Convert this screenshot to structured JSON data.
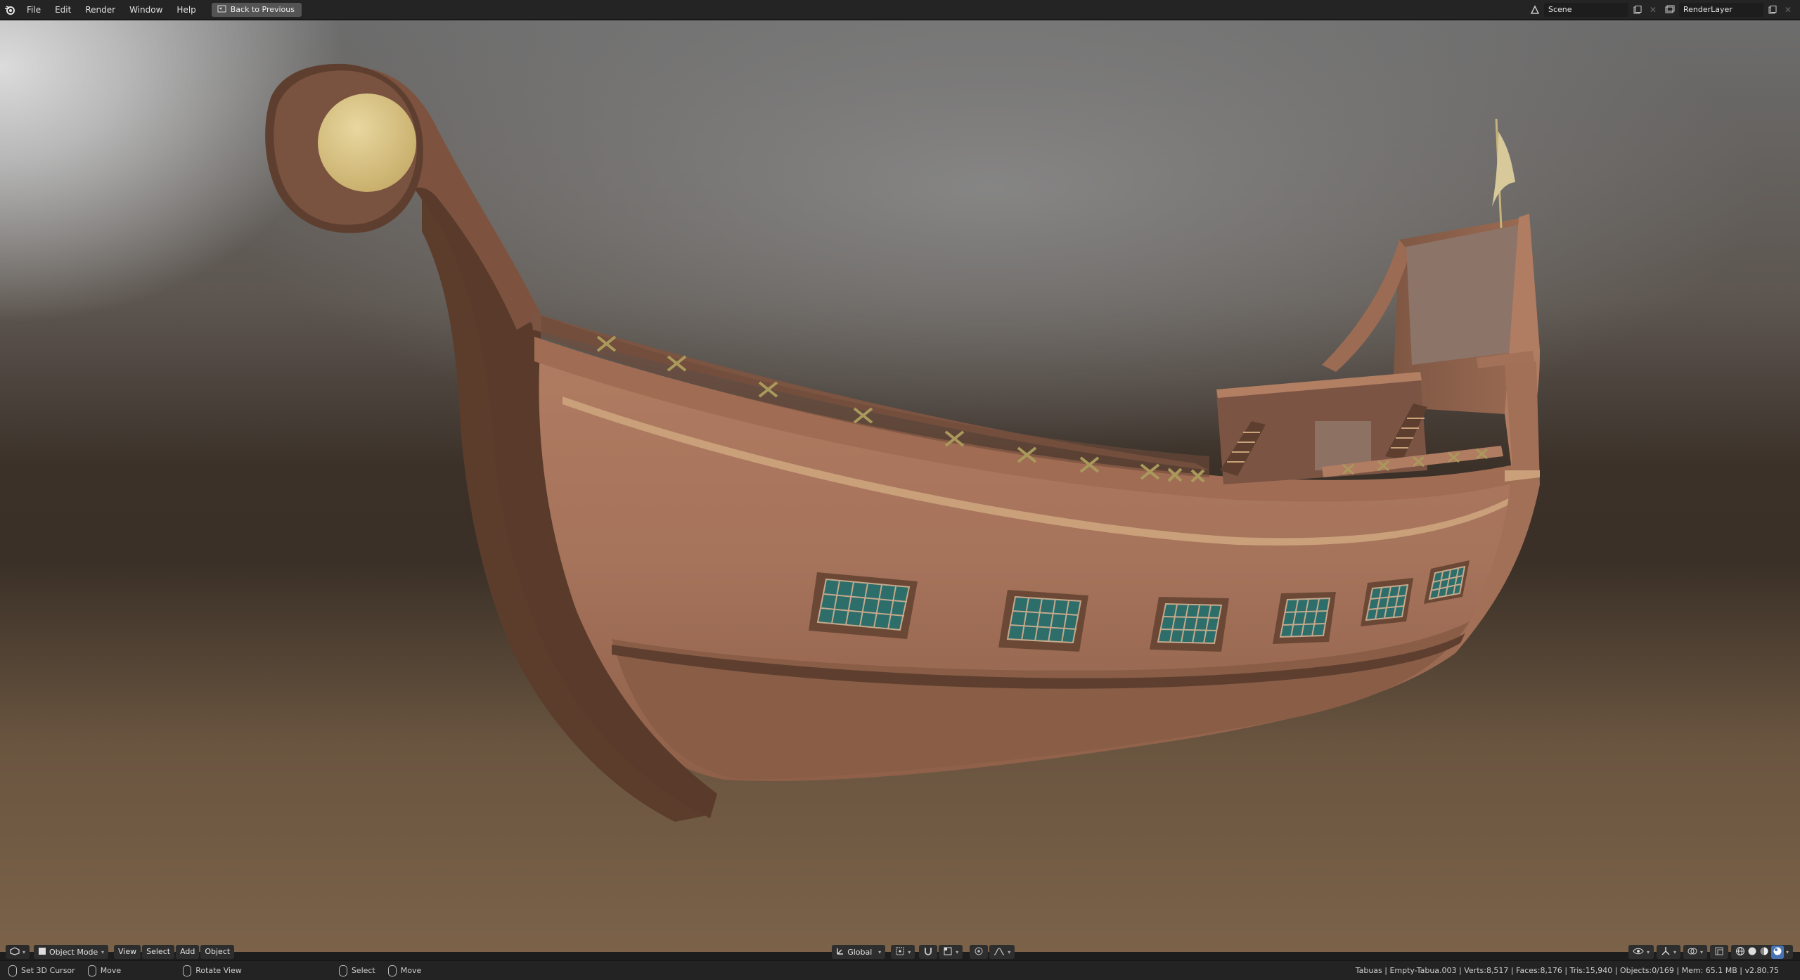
{
  "topbar": {
    "menu": [
      "File",
      "Edit",
      "Render",
      "Window",
      "Help"
    ],
    "back_button": "Back to Previous",
    "scene": "Scene",
    "render_layer": "RenderLayer"
  },
  "viewport_header": {
    "editor_icon": "3d-viewport-icon",
    "mode": "Object Mode",
    "menus": [
      "View",
      "Select",
      "Add",
      "Object"
    ],
    "transform_orientation": "Global"
  },
  "statusbar": {
    "hints": [
      {
        "label": "Set 3D Cursor",
        "icon": "mouse-left-icon"
      },
      {
        "label": "Move",
        "icon": "mouse-left-drag-icon"
      },
      {
        "label": "Rotate View",
        "icon": "mouse-middle-icon"
      },
      {
        "label": "Select",
        "icon": "mouse-right-icon"
      },
      {
        "label": "Move",
        "icon": "mouse-right-drag-icon"
      }
    ],
    "stats": "Tabuas | Empty-Tabua.003 | Verts:8,517 | Faces:8,176 | Tris:15,940 | Objects:0/169 | Mem: 65.1 MB | v2.80.75"
  },
  "colors": {
    "hull": "#a8735a",
    "hull_dark": "#5a3c2c",
    "trim": "#c9a27a",
    "window_glass": "#2d6d6a",
    "moon_ornament": "#d7c285"
  }
}
